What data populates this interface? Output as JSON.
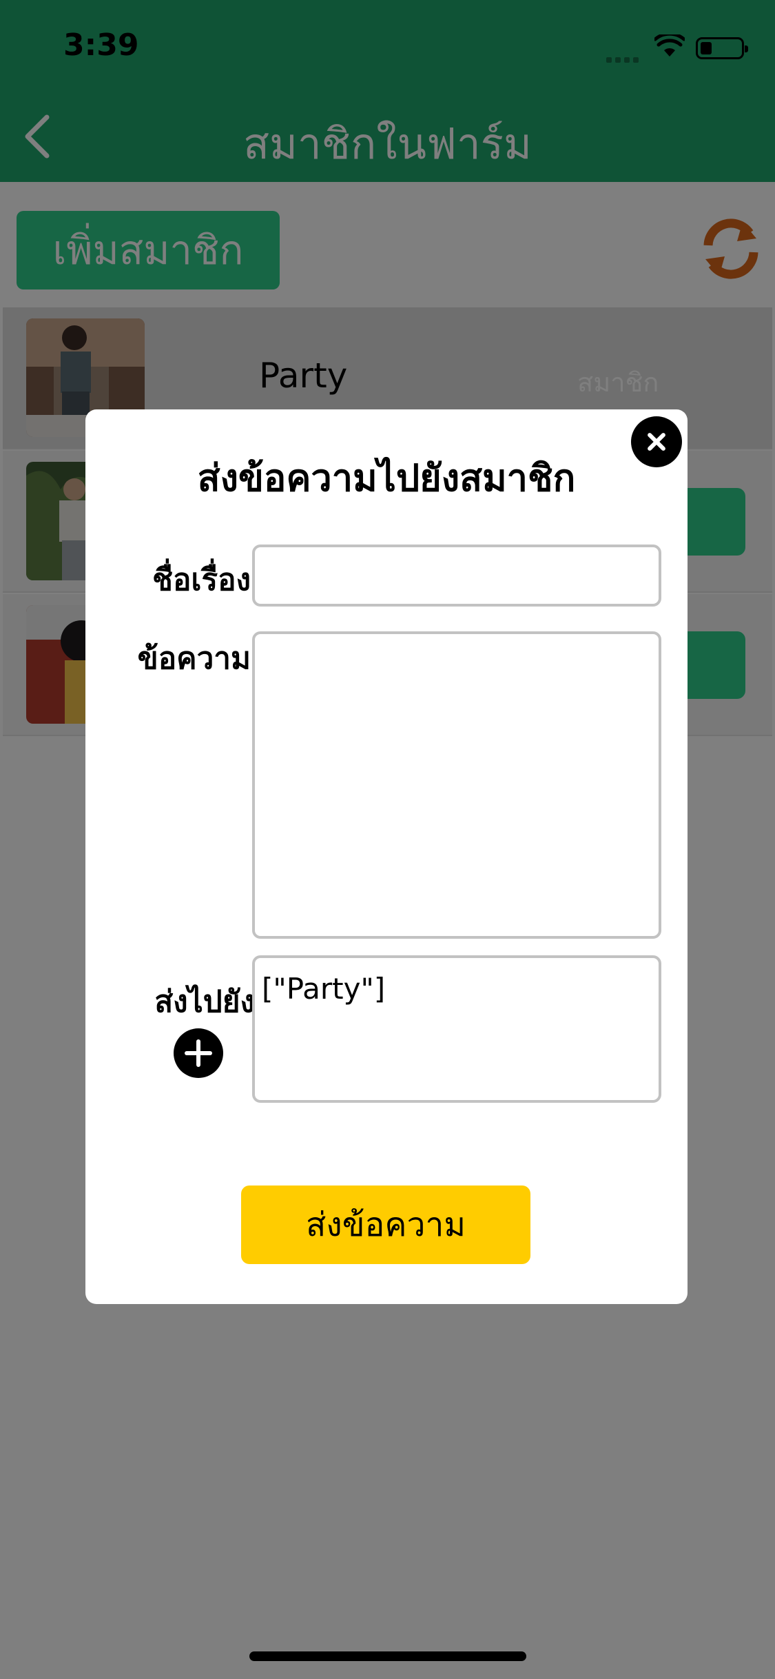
{
  "status_bar": {
    "time": "3:39"
  },
  "nav": {
    "title": "สมาชิกในฟาร์ม"
  },
  "toolbar": {
    "add_member_label": "เพิ่มสมาชิก"
  },
  "members": [
    {
      "name": "Party",
      "role": "สมาชิก"
    },
    {
      "name": "",
      "role": ""
    },
    {
      "name": "",
      "role": ""
    }
  ],
  "modal": {
    "title": "ส่งข้อความไปยังสมาชิก",
    "subject_label": "ชื่อเรื่อง",
    "subject_value": "",
    "message_label": "ข้อความ",
    "message_value": "",
    "send_to_label": "ส่งไปยัง",
    "recipients_value": "[\"Party\"]",
    "send_button_label": "ส่งข้อความ"
  },
  "colors": {
    "header_green": "#1fa66d",
    "button_green": "#2ecc8b",
    "refresh_orange": "#d9661a",
    "send_yellow": "#ffcc00"
  },
  "icons": [
    "back-chevron-icon",
    "refresh-icon",
    "close-icon",
    "add-icon",
    "wifi-icon",
    "battery-icon",
    "signal-icon"
  ]
}
